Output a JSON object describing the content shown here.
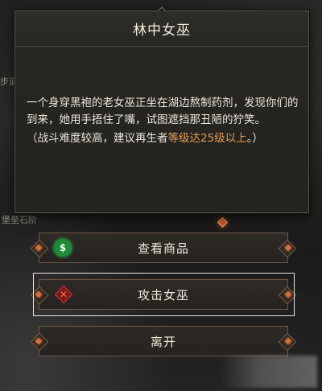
{
  "dialog": {
    "title": "林中女巫",
    "description": "一个身穿黑袍的老女巫正坐在湖边熬制药剂，发现你们的到来，她用手捂住了嘴，试图遮挡那丑陋的狞笑。",
    "hint_prefix": "（战斗难度较高，建议再生者",
    "hint_highlight": "等级达25级以上",
    "hint_suffix": "。）",
    "accent_color": "#e39a55"
  },
  "options": [
    {
      "label": "查看商品",
      "icon": "money-bag-icon",
      "selected": false
    },
    {
      "label": "攻击女巫",
      "icon": "crossed-swords-icon",
      "selected": true
    },
    {
      "label": "离开",
      "icon": "",
      "selected": false
    }
  ],
  "background_labels": {
    "left_top": "步道",
    "left_mid": "堡垒石阶"
  }
}
